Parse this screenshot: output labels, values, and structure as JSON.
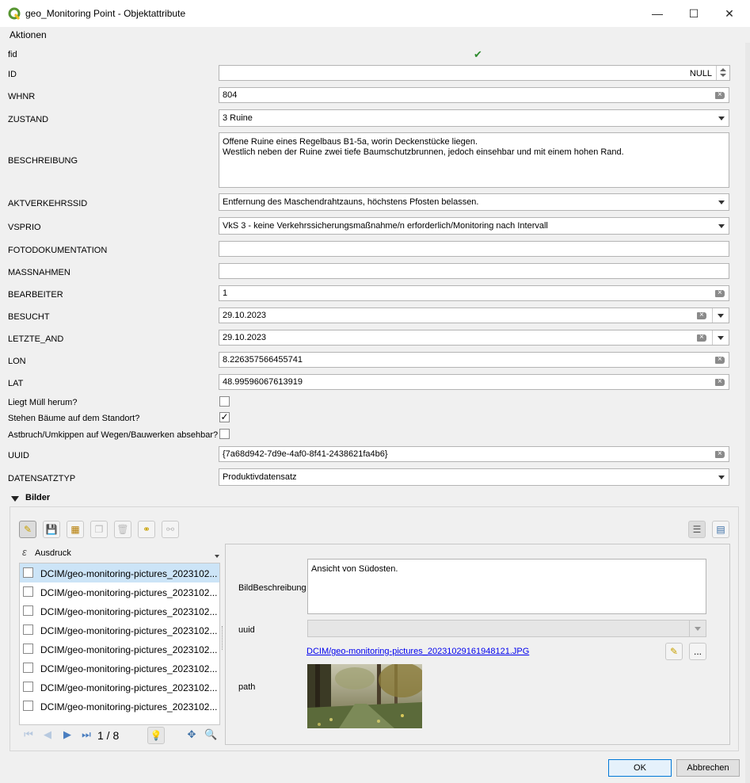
{
  "window": {
    "title": "geo_Monitoring Point - Objektattribute",
    "minimize": "—",
    "maximize": "☐",
    "close": "✕"
  },
  "menu": {
    "aktionen": "Aktionen"
  },
  "fields": {
    "fid": {
      "label": "fid",
      "value": "✔"
    },
    "id": {
      "label": "ID",
      "value": "NULL"
    },
    "whnr": {
      "label": "WHNR",
      "value": "804"
    },
    "zustand": {
      "label": "ZUSTAND",
      "value": "3 Ruine"
    },
    "beschreibung": {
      "label": "BESCHREIBUNG",
      "line1": "Offene Ruine eines Regelbaus B1-5a, worin Deckenstücke liegen.",
      "line2": "Westlich neben der Ruine zwei tiefe Baumschutzbrunnen, jedoch einsehbar und mit einem hohen Rand."
    },
    "aktverkehrssid": {
      "label": "AKTVERKEHRSSID",
      "value": "Entfernung des Maschendrahtzauns, höchstens Pfosten belassen."
    },
    "vsprio": {
      "label": "VSPRIO",
      "value": "VkS 3 - keine Verkehrssicherungsmaßnahme/n erforderlich/Monitoring nach Intervall"
    },
    "fotodokumentation": {
      "label": "FOTODOKUMENTATION",
      "value": ""
    },
    "massnahmen": {
      "label": "MASSNAHMEN",
      "value": ""
    },
    "bearbeiter": {
      "label": "BEARBEITER",
      "value": "1"
    },
    "besucht": {
      "label": "BESUCHT",
      "value": "29.10.2023"
    },
    "letzte_and": {
      "label": "LETZTE_AND",
      "value": "29.10.2023"
    },
    "lon": {
      "label": "LON",
      "value": "8.226357566455741"
    },
    "lat": {
      "label": "LAT",
      "value": "48.99596067613919"
    },
    "muell": {
      "label": "Liegt Müll herum?",
      "checked": false
    },
    "baeume": {
      "label": "Stehen Bäume auf dem Standort?",
      "checked": true,
      "mark": "✓"
    },
    "astbruch": {
      "label": "Astbruch/Umkippen auf Wegen/Bauwerken absehbar?",
      "checked": false
    },
    "uuid": {
      "label": "UUID",
      "value": "{7a68d942-7d9e-4af0-8f41-2438621fa4b6}"
    },
    "datensatztyp": {
      "label": "DATENSATZTYP",
      "value": "Produktivdatensatz"
    }
  },
  "bilder": {
    "header": "Bilder",
    "expression_label": "Ausdruck",
    "items": [
      "DCIM/geo-monitoring-pictures_2023102...",
      "DCIM/geo-monitoring-pictures_2023102...",
      "DCIM/geo-monitoring-pictures_2023102...",
      "DCIM/geo-monitoring-pictures_2023102...",
      "DCIM/geo-monitoring-pictures_2023102...",
      "DCIM/geo-monitoring-pictures_2023102...",
      "DCIM/geo-monitoring-pictures_2023102...",
      "DCIM/geo-monitoring-pictures_2023102..."
    ],
    "pager": "1 / 8",
    "detail": {
      "bildbeschreibung_label": "BildBeschreibung",
      "bildbeschreibung_value": "Ansicht von Südosten.",
      "uuid_label": "uuid",
      "uuid_value": "",
      "path_label": "path",
      "path_link": "DCIM/geo-monitoring-pictures_20231029161948121.JPG",
      "browse": "..."
    }
  },
  "buttons": {
    "ok": "OK",
    "cancel": "Abbrechen"
  },
  "colors": {
    "accent": "#0078d7",
    "link": "#0000ee",
    "qgis_green": "#589632",
    "check_green": "#2e8b2e"
  }
}
